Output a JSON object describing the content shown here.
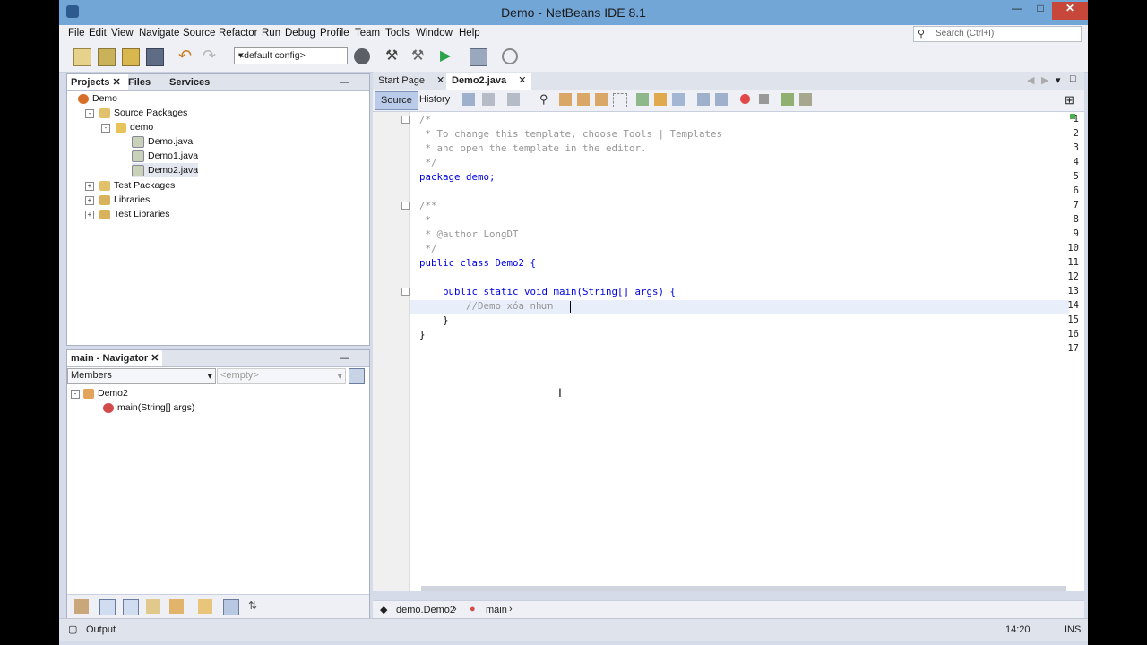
{
  "window": {
    "title": "Demo - NetBeans IDE 8.1"
  },
  "menu": [
    "File",
    "Edit",
    "View",
    "Navigate",
    "Source",
    "Refactor",
    "Run",
    "Debug",
    "Profile",
    "Team",
    "Tools",
    "Window",
    "Help"
  ],
  "search": {
    "placeholder": "Search (Ctrl+I)"
  },
  "toolbar": {
    "config": "<default config>"
  },
  "projects": {
    "tabs": [
      "Projects",
      "Files",
      "Services"
    ],
    "tree": [
      {
        "label": "Demo"
      },
      {
        "label": "Source Packages"
      },
      {
        "label": "demo"
      },
      {
        "label": "Demo.java"
      },
      {
        "label": "Demo1.java"
      },
      {
        "label": "Demo2.java"
      },
      {
        "label": "Test Packages"
      },
      {
        "label": "Libraries"
      },
      {
        "label": "Test Libraries"
      }
    ]
  },
  "navigator": {
    "title": "main - Navigator",
    "members": "Members",
    "filter": "<empty>",
    "tree": [
      {
        "label": "Demo2"
      },
      {
        "label": "main(String[] args)"
      }
    ]
  },
  "editor": {
    "tabs": [
      "Start Page",
      "Demo2.java"
    ],
    "source": "Source",
    "history": "History",
    "lines": [
      {
        "n": "1",
        "text": "/*"
      },
      {
        "n": "2",
        "text": " * To change this template, choose Tools | Templates"
      },
      {
        "n": "3",
        "text": " * and open the template in the editor."
      },
      {
        "n": "4",
        "text": " */"
      },
      {
        "n": "5",
        "text": "package demo;"
      },
      {
        "n": "6",
        "text": ""
      },
      {
        "n": "7",
        "text": "/**"
      },
      {
        "n": "8",
        "text": " *"
      },
      {
        "n": "9",
        "text": " * @author LongDT"
      },
      {
        "n": "10",
        "text": " */"
      },
      {
        "n": "11",
        "text": "public class Demo2 {"
      },
      {
        "n": "12",
        "text": ""
      },
      {
        "n": "13",
        "text": "    public static void main(String[] args) {"
      },
      {
        "n": "14",
        "text": "        //Demo xóa nhưn"
      },
      {
        "n": "15",
        "text": "    }"
      },
      {
        "n": "16",
        "text": "}"
      },
      {
        "n": "17",
        "text": ""
      }
    ],
    "breadcrumb": [
      "demo.Demo2",
      "main"
    ]
  },
  "status": {
    "output": "Output",
    "position": "14:20",
    "mode": "INS"
  }
}
